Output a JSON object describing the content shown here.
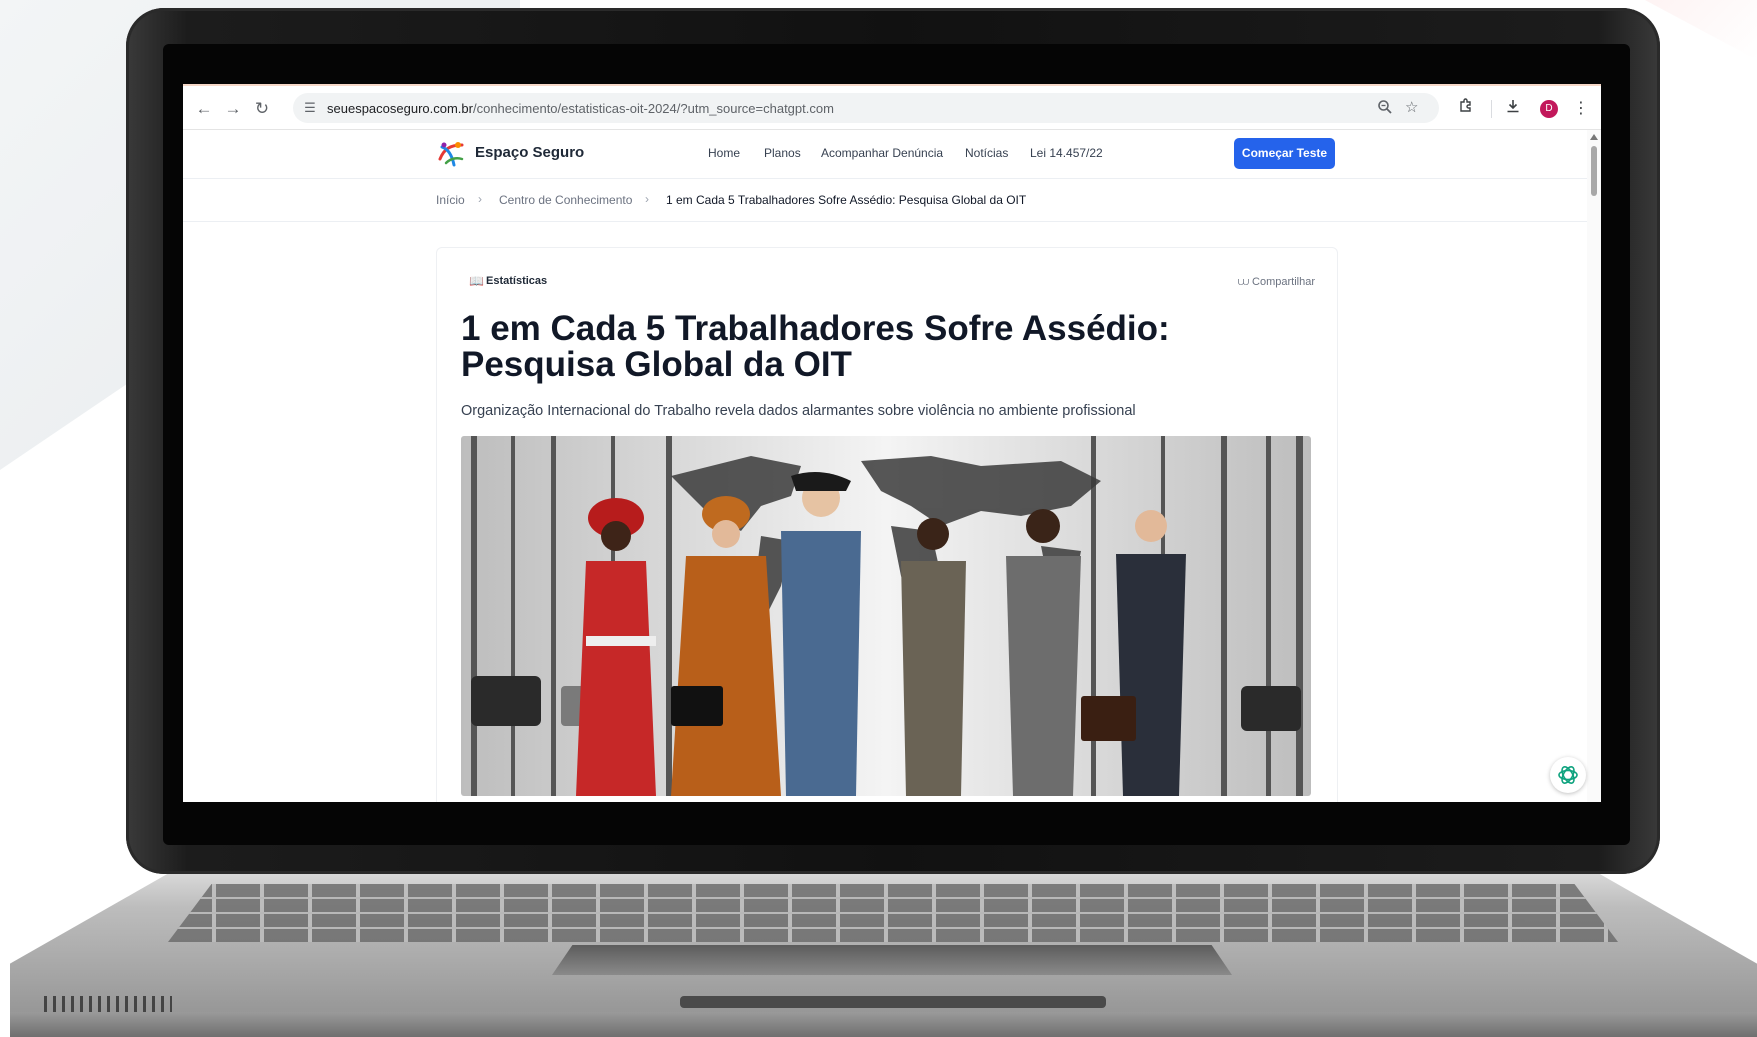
{
  "browser": {
    "url_domain": "seuespacoseguro.com.br",
    "url_path": "/conhecimento/estatisticas-oit-2024/?utm_source=chatgpt.com",
    "avatar_letter": "D",
    "icons": [
      "back-icon",
      "forward-icon",
      "reload-icon",
      "site-settings-icon",
      "zoom-icon",
      "bookmark-star-icon",
      "extensions-icon",
      "download-icon",
      "menu-dots-icon"
    ]
  },
  "site": {
    "brand": "Espaço Seguro",
    "nav": [
      "Home",
      "Planos",
      "Acompanhar Denúncia",
      "Notícias",
      "Lei 14.457/22"
    ],
    "cta_label": "Começar Teste"
  },
  "breadcrumb": {
    "items": [
      "Início",
      "Centro de Conhecimento",
      "1 em Cada 5 Trabalhadores Sofre Assédio: Pesquisa Global da OIT"
    ]
  },
  "article": {
    "category": "Estatísticas",
    "share_label": "Compartilhar",
    "title": "1 em Cada 5 Trabalhadores Sofre Assédio: Pesquisa Global da OIT",
    "subtitle": "Organização Internacional do Trabalho revela dados alarmantes sobre violência no ambiente profissional"
  },
  "colors": {
    "cta": "#2563eb",
    "avatar": "#c2185b",
    "title": "#111827"
  }
}
